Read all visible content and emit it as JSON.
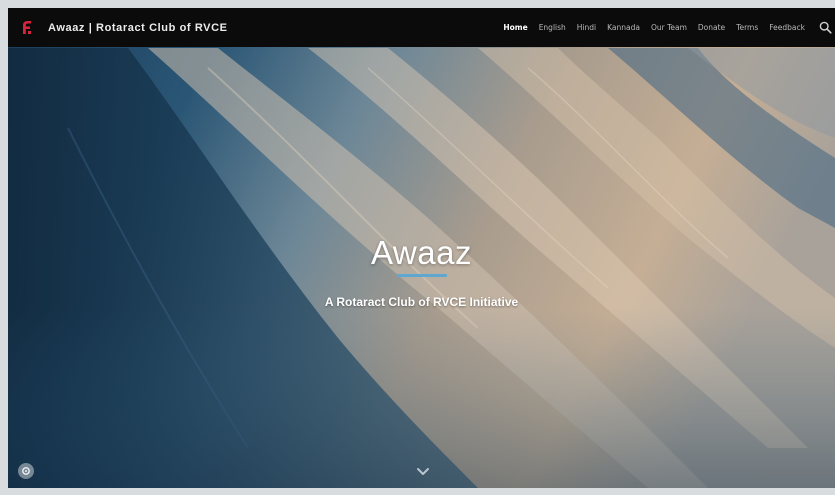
{
  "header": {
    "site_title": "Awaaz | Rotaract Club of RVCE",
    "logo_icon": "rotaract-logo-icon"
  },
  "nav": {
    "items": [
      {
        "label": "Home",
        "active": true
      },
      {
        "label": "English"
      },
      {
        "label": "Hindi"
      },
      {
        "label": "Kannada"
      },
      {
        "label": "Our Team"
      },
      {
        "label": "Donate"
      },
      {
        "label": "Terms"
      },
      {
        "label": "Feedback"
      }
    ],
    "search_icon": "search-icon"
  },
  "hero": {
    "title": "Awaaz",
    "subtitle": "A Rotaract Club of RVCE Initiative",
    "accent_color": "#5da7d1",
    "scroll_icon": "chevron-down-icon"
  },
  "floating_button": {
    "icon": "settings-icon"
  }
}
